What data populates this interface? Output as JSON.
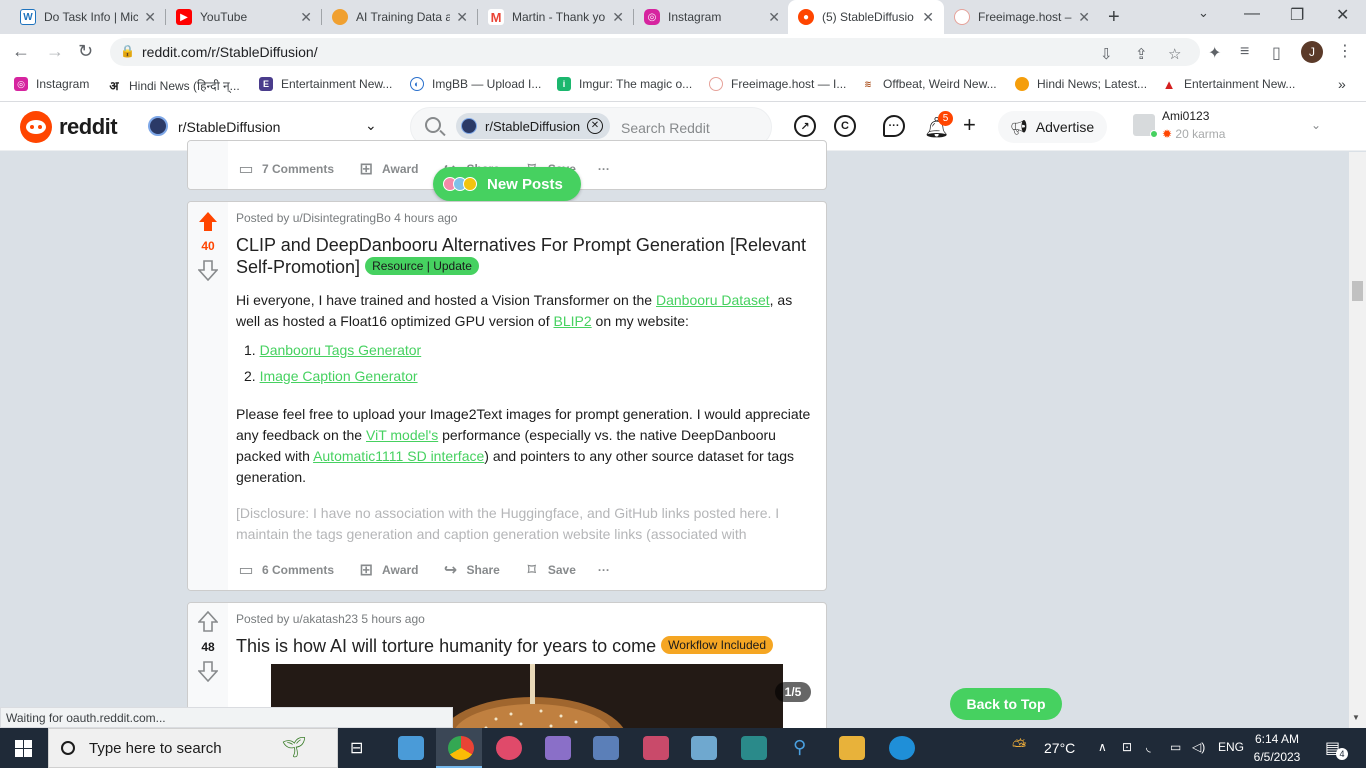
{
  "browser": {
    "tabs": [
      {
        "title": "Do Task Info | Mic",
        "icon": "wordpress-icon",
        "color": "#1e73be"
      },
      {
        "title": "YouTube",
        "icon": "youtube-icon",
        "color": "#ff0000"
      },
      {
        "title": "AI Training Data a",
        "icon": "site-icon",
        "color": "#f0a030"
      },
      {
        "title": "Martin - Thank yo",
        "icon": "gmail-icon",
        "color": "#ea4335"
      },
      {
        "title": "Instagram",
        "icon": "instagram-icon",
        "color": "#d6249f"
      },
      {
        "title": "(5) StableDiffusio",
        "icon": "reddit-icon",
        "color": "#ff4500"
      },
      {
        "title": "Freeimage.host –",
        "icon": "freeimage-icon",
        "color": "#e6a29a"
      }
    ],
    "url": "reddit.com/r/StableDiffusion/",
    "profile_initial": "J",
    "bookmarks": [
      {
        "label": "Instagram",
        "icon": "instagram-icon",
        "color": "#d6249f"
      },
      {
        "label": "Hindi News (हिन्दी न्...",
        "icon": "news-icon",
        "color": "#222222"
      },
      {
        "label": "Entertainment New...",
        "icon": "news-icon",
        "color": "#4a3c8c"
      },
      {
        "label": "ImgBB — Upload I...",
        "icon": "imgbb-icon",
        "color": "#2a70cc"
      },
      {
        "label": "Imgur: The magic o...",
        "icon": "imgur-icon",
        "color": "#1bb76e"
      },
      {
        "label": "Freeimage.host — I...",
        "icon": "freeimage-icon",
        "color": "#e6a29a"
      },
      {
        "label": "Offbeat, Weird New...",
        "icon": "news-icon",
        "color": "#b05a2a"
      },
      {
        "label": "Hindi News; Latest...",
        "icon": "news-icon",
        "color": "#f59e0b"
      },
      {
        "label": "Entertainment New...",
        "icon": "news-icon",
        "color": "#d42020"
      }
    ]
  },
  "reddit": {
    "wordmark": "reddit",
    "community": "r/StableDiffusion",
    "search_chip": "r/StableDiffusion",
    "search_placeholder": "Search Reddit",
    "notification_count": "5",
    "advertise_label": "Advertise",
    "username": "Ami0123",
    "karma": "20 karma",
    "new_posts_label": "New Posts",
    "back_to_top_label": "Back to Top",
    "accent_color": "#46d160",
    "upvote_color": "#ff4500"
  },
  "posts": [
    {
      "comments": "7 Comments",
      "award": "Award",
      "share": "Share",
      "save": "Save"
    },
    {
      "meta": "Posted by u/DisintegratingBo 4 hours ago",
      "score": "40",
      "upvoted": true,
      "title": "CLIP and DeepDanbooru Alternatives For Prompt Generation [Relevant Self-Promotion]",
      "flair": "Resource | Update",
      "flair_color": "#46d160",
      "p1_a": "Hi everyone, I have trained and hosted a Vision Transformer on the ",
      "p1_link1": "Danbooru Dataset",
      "p1_b": ", as well as hosted a Float16 optimized GPU version of ",
      "p1_link2": "BLIP2",
      "p1_c": " on my website:",
      "list": [
        "Danbooru Tags Generator",
        "Image Caption Generator"
      ],
      "p2_a": "Please feel free to upload your Image2Text images for prompt generation. I would appreciate any feedback on the ",
      "p2_link1": "ViT model's",
      "p2_b": " performance (especially vs. the native DeepDanbooru packed with ",
      "p2_link2": "Automatic1111 SD interface",
      "p2_c": ") and pointers to any other source dataset for tags generation.",
      "p3": "[Disclosure: I have no association with the Huggingface, and GitHub links posted here. I maintain the tags generation and caption generation website links (associated with",
      "comments": "6 Comments",
      "award": "Award",
      "share": "Share",
      "save": "Save"
    },
    {
      "meta": "Posted by u/akatash23 5 hours ago",
      "score": "48",
      "title": "This is how AI will torture humanity for years to come",
      "flair": "Workflow Included",
      "flair_color": "#f5a623",
      "gallery_counter": "1/5"
    }
  ],
  "status_text": "Waiting for oauth.reddit.com...",
  "taskbar": {
    "search_placeholder": "Type here to search",
    "temperature": "27°C",
    "language": "ENG",
    "time": "6:14 AM",
    "date": "6/5/2023",
    "notifications": "4"
  }
}
